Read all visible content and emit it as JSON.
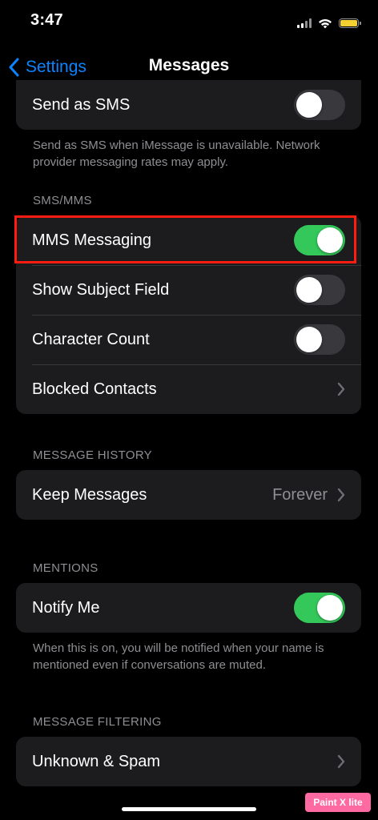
{
  "status_bar": {
    "time": "3:47"
  },
  "nav": {
    "back_label": "Settings",
    "title": "Messages"
  },
  "group_imessage": {
    "send_as_sms": {
      "label": "Send as SMS",
      "on": false
    },
    "footer": "Send as SMS when iMessage is unavailable. Network provider messaging rates may apply."
  },
  "sms_mms": {
    "header": "SMS/MMS",
    "items": [
      {
        "label": "MMS Messaging",
        "on": true
      },
      {
        "label": "Show Subject Field",
        "on": false
      },
      {
        "label": "Character Count",
        "on": false
      },
      {
        "label": "Blocked Contacts"
      }
    ]
  },
  "message_history": {
    "header": "MESSAGE HISTORY",
    "keep_messages": {
      "label": "Keep Messages",
      "value": "Forever"
    }
  },
  "mentions": {
    "header": "MENTIONS",
    "notify_me": {
      "label": "Notify Me",
      "on": true
    },
    "footer": "When this is on, you will be notified when your name is mentioned even if conversations are muted."
  },
  "message_filtering": {
    "header": "MESSAGE FILTERING",
    "unknown_spam": {
      "label": "Unknown & Spam"
    }
  },
  "watermark": "Paint X lite",
  "colors": {
    "accent": "#0a84ff",
    "toggle_on": "#34c759",
    "highlight_border": "#ff1d12",
    "cell_background": "#1c1c1e"
  },
  "icons": [
    "cellular-signal-icon",
    "wifi-icon",
    "battery-icon",
    "back-chevron-icon",
    "chevron-right-icon"
  ]
}
